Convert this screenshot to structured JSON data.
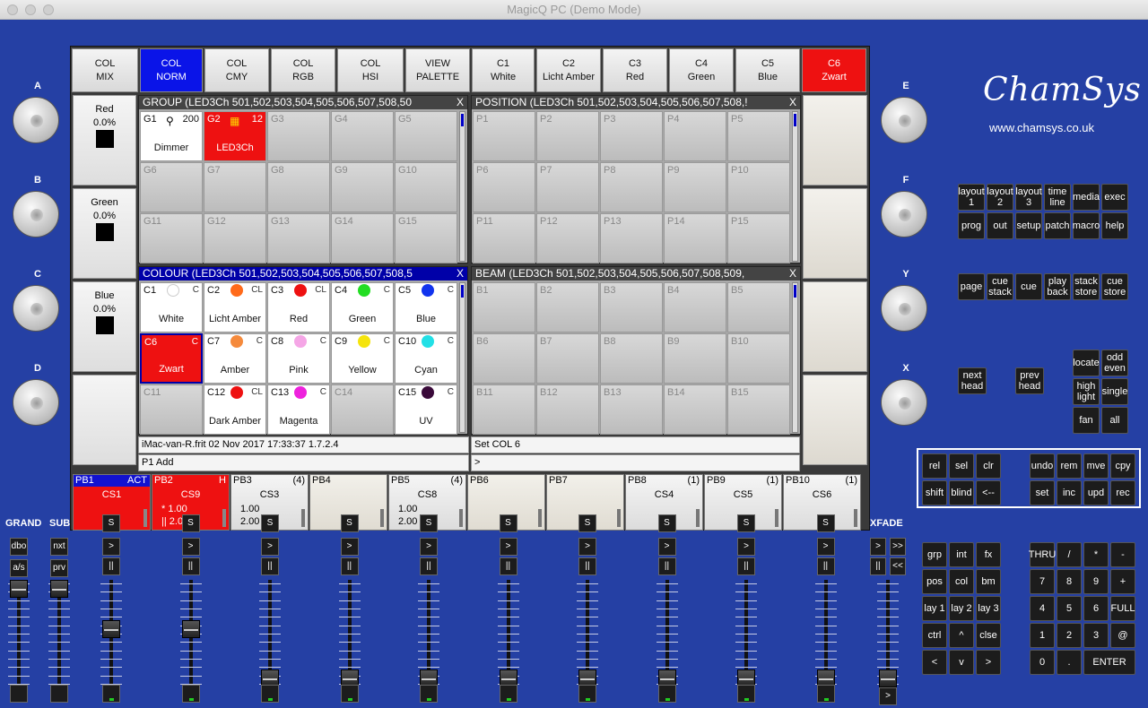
{
  "window": {
    "title": "MagicQ PC (Demo Mode)"
  },
  "top_buttons": [
    {
      "label": "COL\nMIX",
      "state": "normal"
    },
    {
      "label": "COL\nNORM",
      "state": "blue"
    },
    {
      "label": "COL\nCMY",
      "state": "normal"
    },
    {
      "label": "COL\nRGB",
      "state": "normal"
    },
    {
      "label": "COL\nHSI",
      "state": "normal"
    },
    {
      "label": "VIEW\nPALETTE",
      "state": "normal"
    },
    {
      "label": "C1\nWhite",
      "state": "normal"
    },
    {
      "label": "C2\nLicht Amber",
      "state": "normal"
    },
    {
      "label": "C3\nRed",
      "state": "normal"
    },
    {
      "label": "C4\nGreen",
      "state": "normal"
    },
    {
      "label": "C5\nBlue",
      "state": "normal"
    },
    {
      "label": "C6\nZwart",
      "state": "red"
    }
  ],
  "encoders_left": [
    {
      "name": "Red",
      "value": "0.0%"
    },
    {
      "name": "Green",
      "value": "0.0%"
    },
    {
      "name": "Blue",
      "value": "0.0%"
    }
  ],
  "group_window": {
    "title": "GROUP (LED3Ch 501,502,503,504,505,506,507,508,50",
    "close": "X",
    "cells": [
      {
        "id": "G1",
        "name": "Dimmer",
        "count": "200",
        "icon": "lamp-icon",
        "state": "on"
      },
      {
        "id": "G2",
        "name": "LED3Ch",
        "count": "12",
        "icon": "rgb-led-icon",
        "state": "sel"
      },
      {
        "id": "G3"
      },
      {
        "id": "G4"
      },
      {
        "id": "G5"
      },
      {
        "id": "G6"
      },
      {
        "id": "G7"
      },
      {
        "id": "G8"
      },
      {
        "id": "G9"
      },
      {
        "id": "G10"
      },
      {
        "id": "G11"
      },
      {
        "id": "G12"
      },
      {
        "id": "G13"
      },
      {
        "id": "G14"
      },
      {
        "id": "G15"
      }
    ]
  },
  "position_window": {
    "title": "POSITION (LED3Ch 501,502,503,504,505,506,507,508,!",
    "close": "X",
    "cells": [
      "P1",
      "P2",
      "P3",
      "P4",
      "P5",
      "P6",
      "P7",
      "P8",
      "P9",
      "P10",
      "P11",
      "P12",
      "P13",
      "P14",
      "P15"
    ]
  },
  "colour_window": {
    "title": "COLOUR (LED3Ch 501,502,503,504,505,506,507,508,5",
    "close": "X",
    "cells": [
      {
        "id": "C1",
        "name": "White",
        "color": "#ffffff",
        "tag": "C",
        "state": "on"
      },
      {
        "id": "C2",
        "name": "Licht Amber",
        "color": "#ff6a1a",
        "tag": "CL",
        "state": "on"
      },
      {
        "id": "C3",
        "name": "Red",
        "color": "#ee1111",
        "tag": "CL",
        "state": "on"
      },
      {
        "id": "C4",
        "name": "Green",
        "color": "#22dd22",
        "tag": "C",
        "state": "on"
      },
      {
        "id": "C5",
        "name": "Blue",
        "color": "#1133ee",
        "tag": "C",
        "state": "on"
      },
      {
        "id": "C6",
        "name": "Zwart",
        "color": "",
        "tag": "C",
        "state": "sel"
      },
      {
        "id": "C7",
        "name": "Amber",
        "color": "#f58a3c",
        "tag": "C",
        "state": "on"
      },
      {
        "id": "C8",
        "name": "Pink",
        "color": "#f5a6e6",
        "tag": "C",
        "state": "on"
      },
      {
        "id": "C9",
        "name": "Yellow",
        "color": "#f5e40c",
        "tag": "C",
        "state": "on"
      },
      {
        "id": "C10",
        "name": "Cyan",
        "color": "#22e0e6",
        "tag": "C",
        "state": "on"
      },
      {
        "id": "C11",
        "name": "",
        "color": "",
        "tag": "",
        "state": "off"
      },
      {
        "id": "C12",
        "name": "Dark Amber",
        "color": "#ee1111",
        "tag": "CL",
        "state": "on"
      },
      {
        "id": "C13",
        "name": "Magenta",
        "color": "#ee22dd",
        "tag": "C",
        "state": "on"
      },
      {
        "id": "C14",
        "name": "",
        "color": "",
        "tag": "",
        "state": "off"
      },
      {
        "id": "C15",
        "name": "UV",
        "color": "#3a0a3a",
        "tag": "C",
        "state": "on"
      }
    ]
  },
  "beam_window": {
    "title": "BEAM (LED3Ch 501,502,503,504,505,506,507,508,509,",
    "close": "X",
    "cells": [
      "B1",
      "B2",
      "B3",
      "B4",
      "B5",
      "B6",
      "B7",
      "B8",
      "B9",
      "B10",
      "B11",
      "B12",
      "B13",
      "B14",
      "B15"
    ]
  },
  "status": {
    "line1": "iMac-van-R.frit 02 Nov 2017 17:33:37 1.7.2.4",
    "line2": "P1  Add",
    "cmd1": "Set COL 6",
    "cmd2": ">"
  },
  "playbacks": [
    {
      "id": "PB1",
      "badge": "ACT",
      "name": "CS1",
      "v1": "",
      "v2": "",
      "state": "act"
    },
    {
      "id": "PB2",
      "badge": "H",
      "name": "CS9",
      "v1": "* 1.00",
      "v2": "|| 2.00",
      "state": "act2"
    },
    {
      "id": "PB3",
      "badge": "(4)",
      "name": "CS3",
      "v1": "1.00",
      "v2": "2.00",
      "state": "normal"
    },
    {
      "id": "PB4",
      "badge": "",
      "name": "",
      "v1": "",
      "v2": "",
      "state": "empty"
    },
    {
      "id": "PB5",
      "badge": "(4)",
      "name": "CS8",
      "v1": "1.00",
      "v2": "2.00",
      "state": "normal"
    },
    {
      "id": "PB6",
      "badge": "",
      "name": "",
      "v1": "",
      "v2": "",
      "state": "empty"
    },
    {
      "id": "PB7",
      "badge": "",
      "name": "",
      "v1": "",
      "v2": "",
      "state": "empty"
    },
    {
      "id": "PB8",
      "badge": "(1)",
      "name": "CS4",
      "v1": "",
      "v2": "",
      "state": "normal"
    },
    {
      "id": "PB9",
      "badge": "(1)",
      "name": "CS5",
      "v1": "",
      "v2": "",
      "state": "normal"
    },
    {
      "id": "PB10",
      "badge": "(1)",
      "name": "CS6",
      "v1": "",
      "v2": "",
      "state": "normal"
    }
  ],
  "knobs_left": [
    "A",
    "B",
    "C",
    "D"
  ],
  "knobs_right": [
    "E",
    "F",
    "Y",
    "X"
  ],
  "brand": {
    "logo": "ChamSys",
    "url": "www.chamsys.co.uk"
  },
  "keys_group1": [
    [
      "layout\n1",
      "layout\n2",
      "layout\n3",
      "time\nline",
      "media",
      "exec"
    ],
    [
      "prog",
      "out",
      "setup",
      "patch",
      "macro",
      "help"
    ]
  ],
  "keys_group2": [
    "page",
    "cue\nstack",
    "cue",
    "play\nback",
    "stack\nstore",
    "cue\nstore"
  ],
  "keys_head": [
    "next\nhead",
    "prev\nhead"
  ],
  "keys_locate": [
    "locate",
    "odd\neven",
    "high\nlight",
    "single",
    "fan",
    "all"
  ],
  "keys_edit_left": [
    "rel",
    "sel",
    "clr",
    "shift",
    "blind",
    "<--"
  ],
  "keys_edit_right": [
    "undo",
    "rem",
    "mve",
    "cpy",
    "set",
    "inc",
    "upd",
    "rec"
  ],
  "keys_func": [
    "grp",
    "int",
    "fx",
    "pos",
    "col",
    "bm",
    "lay 1",
    "lay 2",
    "lay 3",
    "ctrl",
    "^",
    "clse",
    "<",
    "v",
    ">"
  ],
  "keys_num": [
    "THRU",
    "/",
    "*",
    "-",
    "7",
    "8",
    "9",
    "+",
    "4",
    "5",
    "6",
    "FULL",
    "1",
    "2",
    "3",
    "@",
    "0",
    ".",
    "ENTER"
  ],
  "fader_labels": {
    "grand": "GRAND",
    "sub": "SUB",
    "xfade": "XFADE"
  },
  "grand_keys": [
    "dbo",
    "a/s"
  ],
  "sub_keys": [
    "nxt",
    "prv"
  ],
  "xfade_keys": [
    ">",
    ">>",
    "||",
    "<<",
    ">"
  ],
  "pb_fader_keys": {
    "s": "S",
    "go": ">",
    "pause": "||"
  },
  "fader_levels": {
    "grand": 1.0,
    "sub": 1.0,
    "pb": [
      0.55,
      0.55,
      0.0,
      0.0,
      0.0,
      0.0,
      0.0,
      0.0,
      0.0,
      0.0
    ],
    "xfade": 0.0
  }
}
